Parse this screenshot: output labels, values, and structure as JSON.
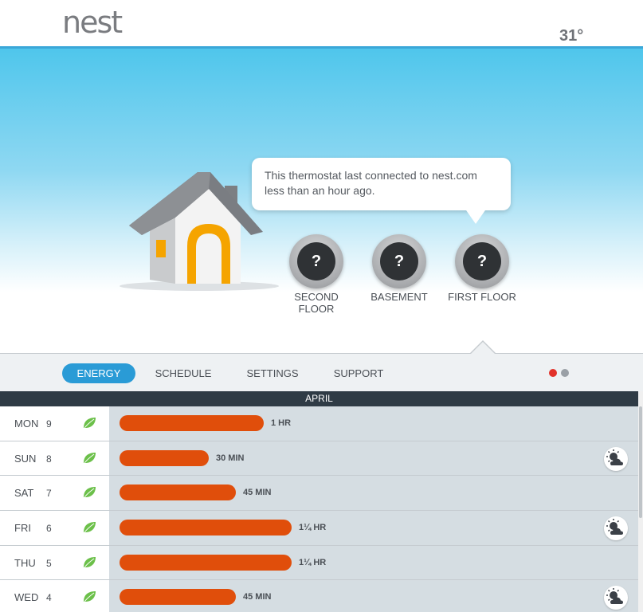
{
  "header": {
    "logo": "nest",
    "outdoor_temp": "31°"
  },
  "status_message": "This thermostat last connected to nest.com less than an hour ago.",
  "thermostats": [
    {
      "label_line1": "SECOND",
      "label_line2": "FLOOR",
      "display": "?"
    },
    {
      "label_line1": "BASEMENT",
      "label_line2": "",
      "display": "?"
    },
    {
      "label_line1": "FIRST FLOOR",
      "label_line2": "",
      "display": "?"
    }
  ],
  "nav": {
    "tabs": [
      "ENERGY",
      "SCHEDULE",
      "SETTINGS",
      "SUPPORT"
    ],
    "active": "ENERGY"
  },
  "energy": {
    "month": "APRIL",
    "rows": [
      {
        "day": "MON",
        "date": "9",
        "duration": "1 HR",
        "hours": 1.0,
        "weather": false
      },
      {
        "day": "SUN",
        "date": "8",
        "duration": "30 MIN",
        "hours": 0.5,
        "weather": true
      },
      {
        "day": "SAT",
        "date": "7",
        "duration": "45 MIN",
        "hours": 0.75,
        "weather": false
      },
      {
        "day": "FRI",
        "date": "6",
        "duration": "1¼ HR",
        "hours": 1.25,
        "weather": true
      },
      {
        "day": "THU",
        "date": "5",
        "duration": "1¼ HR",
        "hours": 1.25,
        "weather": false
      },
      {
        "day": "WED",
        "date": "4",
        "duration": "45 MIN",
        "hours": 0.75,
        "weather": true
      }
    ]
  },
  "colors": {
    "accent": "#2a9bd6",
    "usage_bar": "#e04e0b",
    "leaf": "#6cc04a",
    "dot_active": "#e2322a",
    "dot_inactive": "#9aa0a6"
  },
  "icons": {
    "leaf": "leaf-icon",
    "weather": "partly-cloudy-icon",
    "house": "house-icon"
  }
}
